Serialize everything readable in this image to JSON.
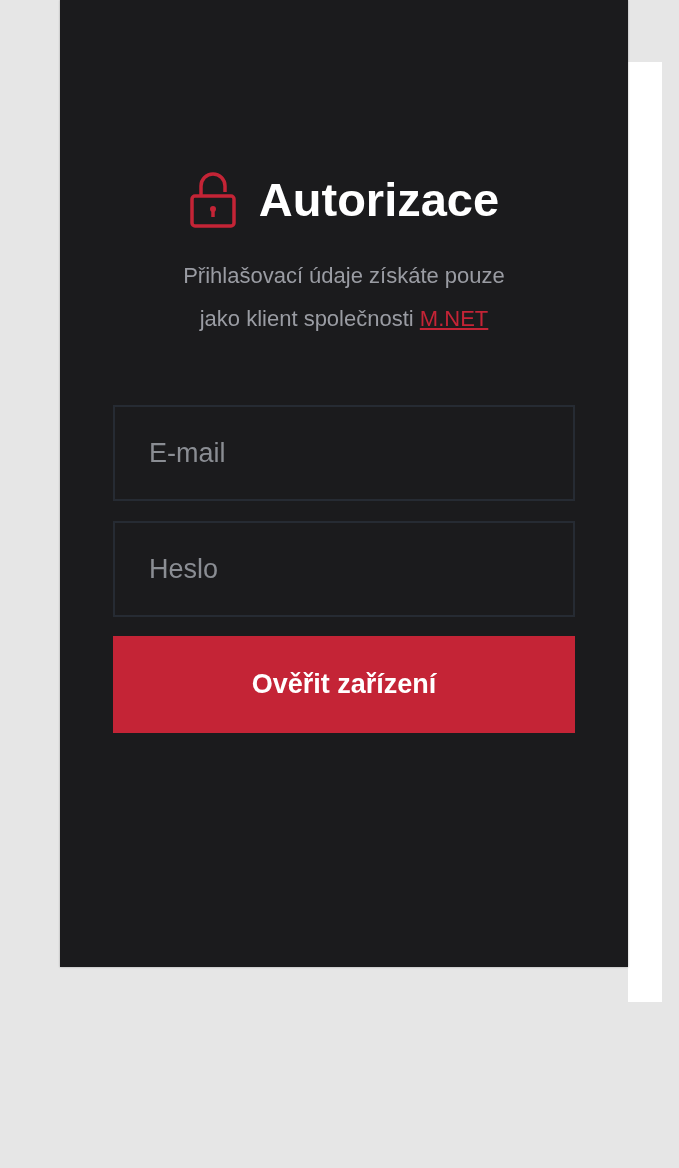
{
  "title": "Autorizace",
  "subtitle": {
    "line_1": "Přihlašovací údaje získáte pouze",
    "line_2": "jako klient společnosti",
    "link": "M.NET"
  },
  "fields": [
    {
      "placeholder": "E-mail"
    },
    {
      "placeholder": "Heslo"
    }
  ],
  "button": "Ověřit zařízení"
}
